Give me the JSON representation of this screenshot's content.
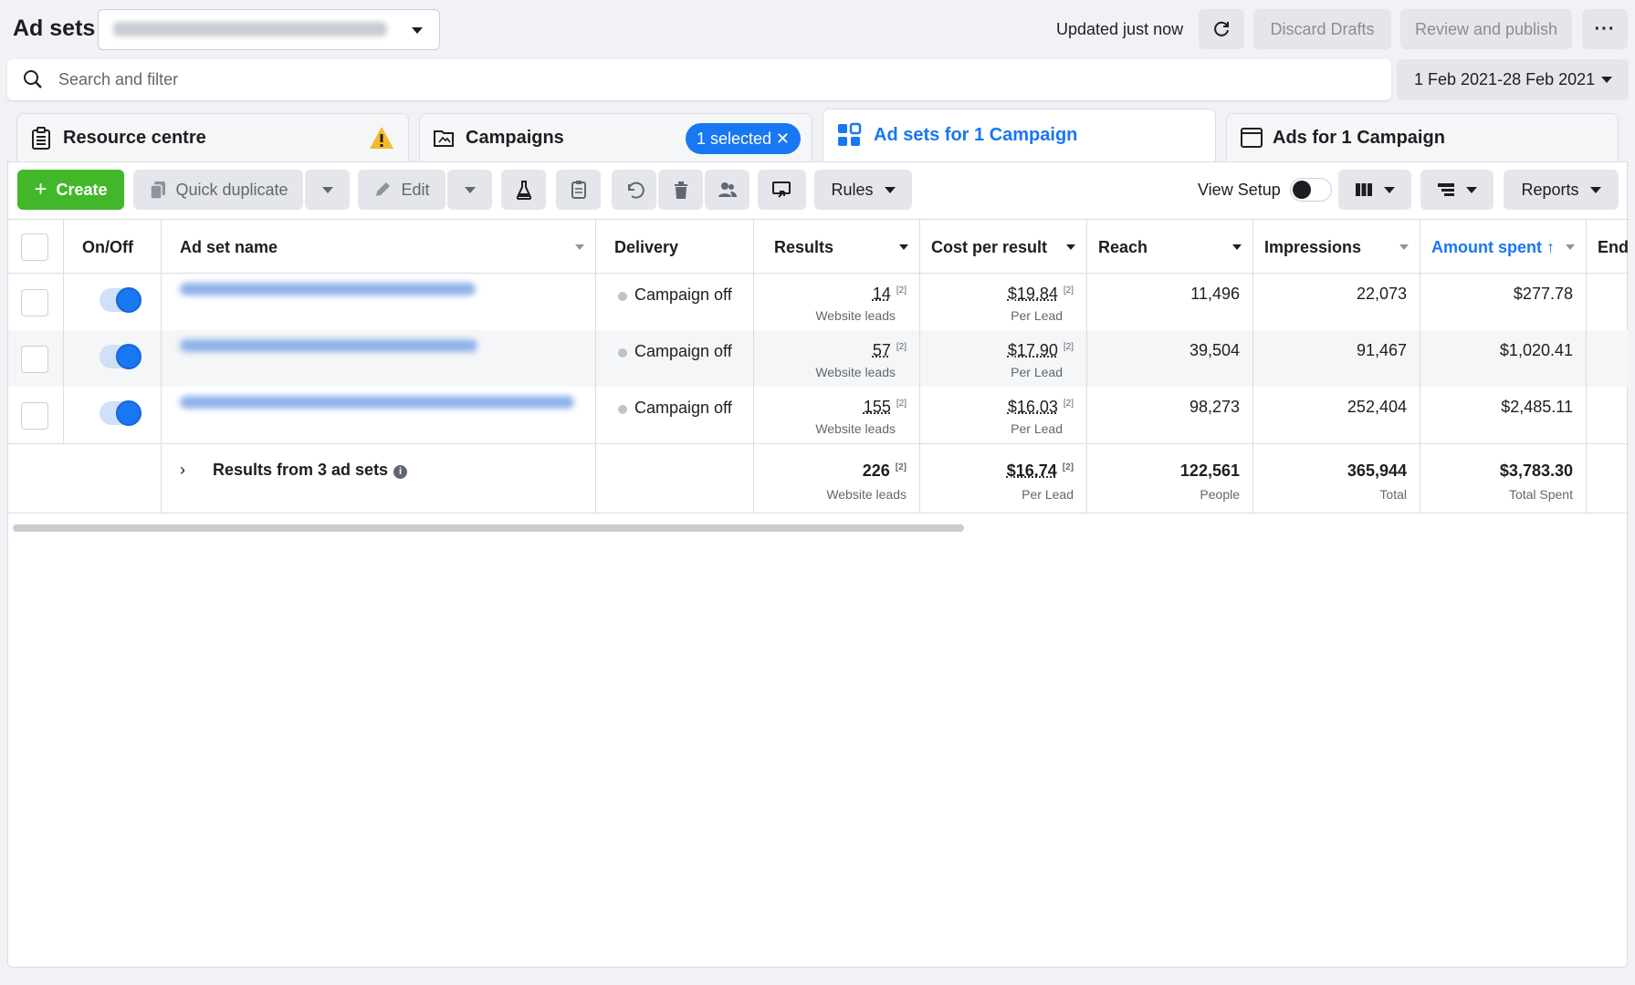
{
  "header": {
    "title": "Ad sets",
    "updated_text": "Updated just now",
    "discard_label": "Discard Drafts",
    "review_label": "Review and publish"
  },
  "search": {
    "placeholder": "Search and filter"
  },
  "date_range": "1 Feb 2021-28 Feb 2021",
  "tabs": [
    {
      "label": "Resource centre"
    },
    {
      "label": "Campaigns",
      "selected_pill": "1 selected"
    },
    {
      "label": "Ad sets for 1 Campaign"
    },
    {
      "label": "Ads for 1 Campaign"
    }
  ],
  "toolbar": {
    "create_label": "Create",
    "quick_duplicate_label": "Quick duplicate",
    "edit_label": "Edit",
    "rules_label": "Rules",
    "view_setup_label": "View Setup",
    "reports_label": "Reports"
  },
  "table": {
    "columns": [
      "On/Off",
      "Ad set name",
      "Delivery",
      "Results",
      "Cost per result",
      "Reach",
      "Impressions",
      "Amount spent",
      "Ends"
    ],
    "rows": [
      {
        "delivery": "Campaign off",
        "results": "14",
        "results_sub": "Website leads",
        "cpr": "$19.84",
        "cpr_sub": "Per Lead",
        "reach": "11,496",
        "impressions": "22,073",
        "amount": "$277.78",
        "on": true
      },
      {
        "delivery": "Campaign off",
        "results": "57",
        "results_sub": "Website leads",
        "cpr": "$17.90",
        "cpr_sub": "Per Lead",
        "reach": "39,504",
        "impressions": "91,467",
        "amount": "$1,020.41",
        "on": true
      },
      {
        "delivery": "Campaign off",
        "results": "155",
        "results_sub": "Website leads",
        "cpr": "$16.03",
        "cpr_sub": "Per Lead",
        "reach": "98,273",
        "impressions": "252,404",
        "amount": "$2,485.11",
        "on": true
      }
    ],
    "footnote_marker": "[2]",
    "totals": {
      "label": "Results from 3 ad sets",
      "results": "226",
      "results_sub": "Website leads",
      "cpr": "$16.74",
      "cpr_sub": "Per Lead",
      "reach": "122,561",
      "reach_sub": "People",
      "impressions": "365,944",
      "impressions_sub": "Total",
      "amount": "$3,783.30",
      "amount_sub": "Total Spent"
    }
  },
  "colors": {
    "accent": "#1877f2",
    "create_green": "#42b72a",
    "warning": "#f7b928"
  }
}
